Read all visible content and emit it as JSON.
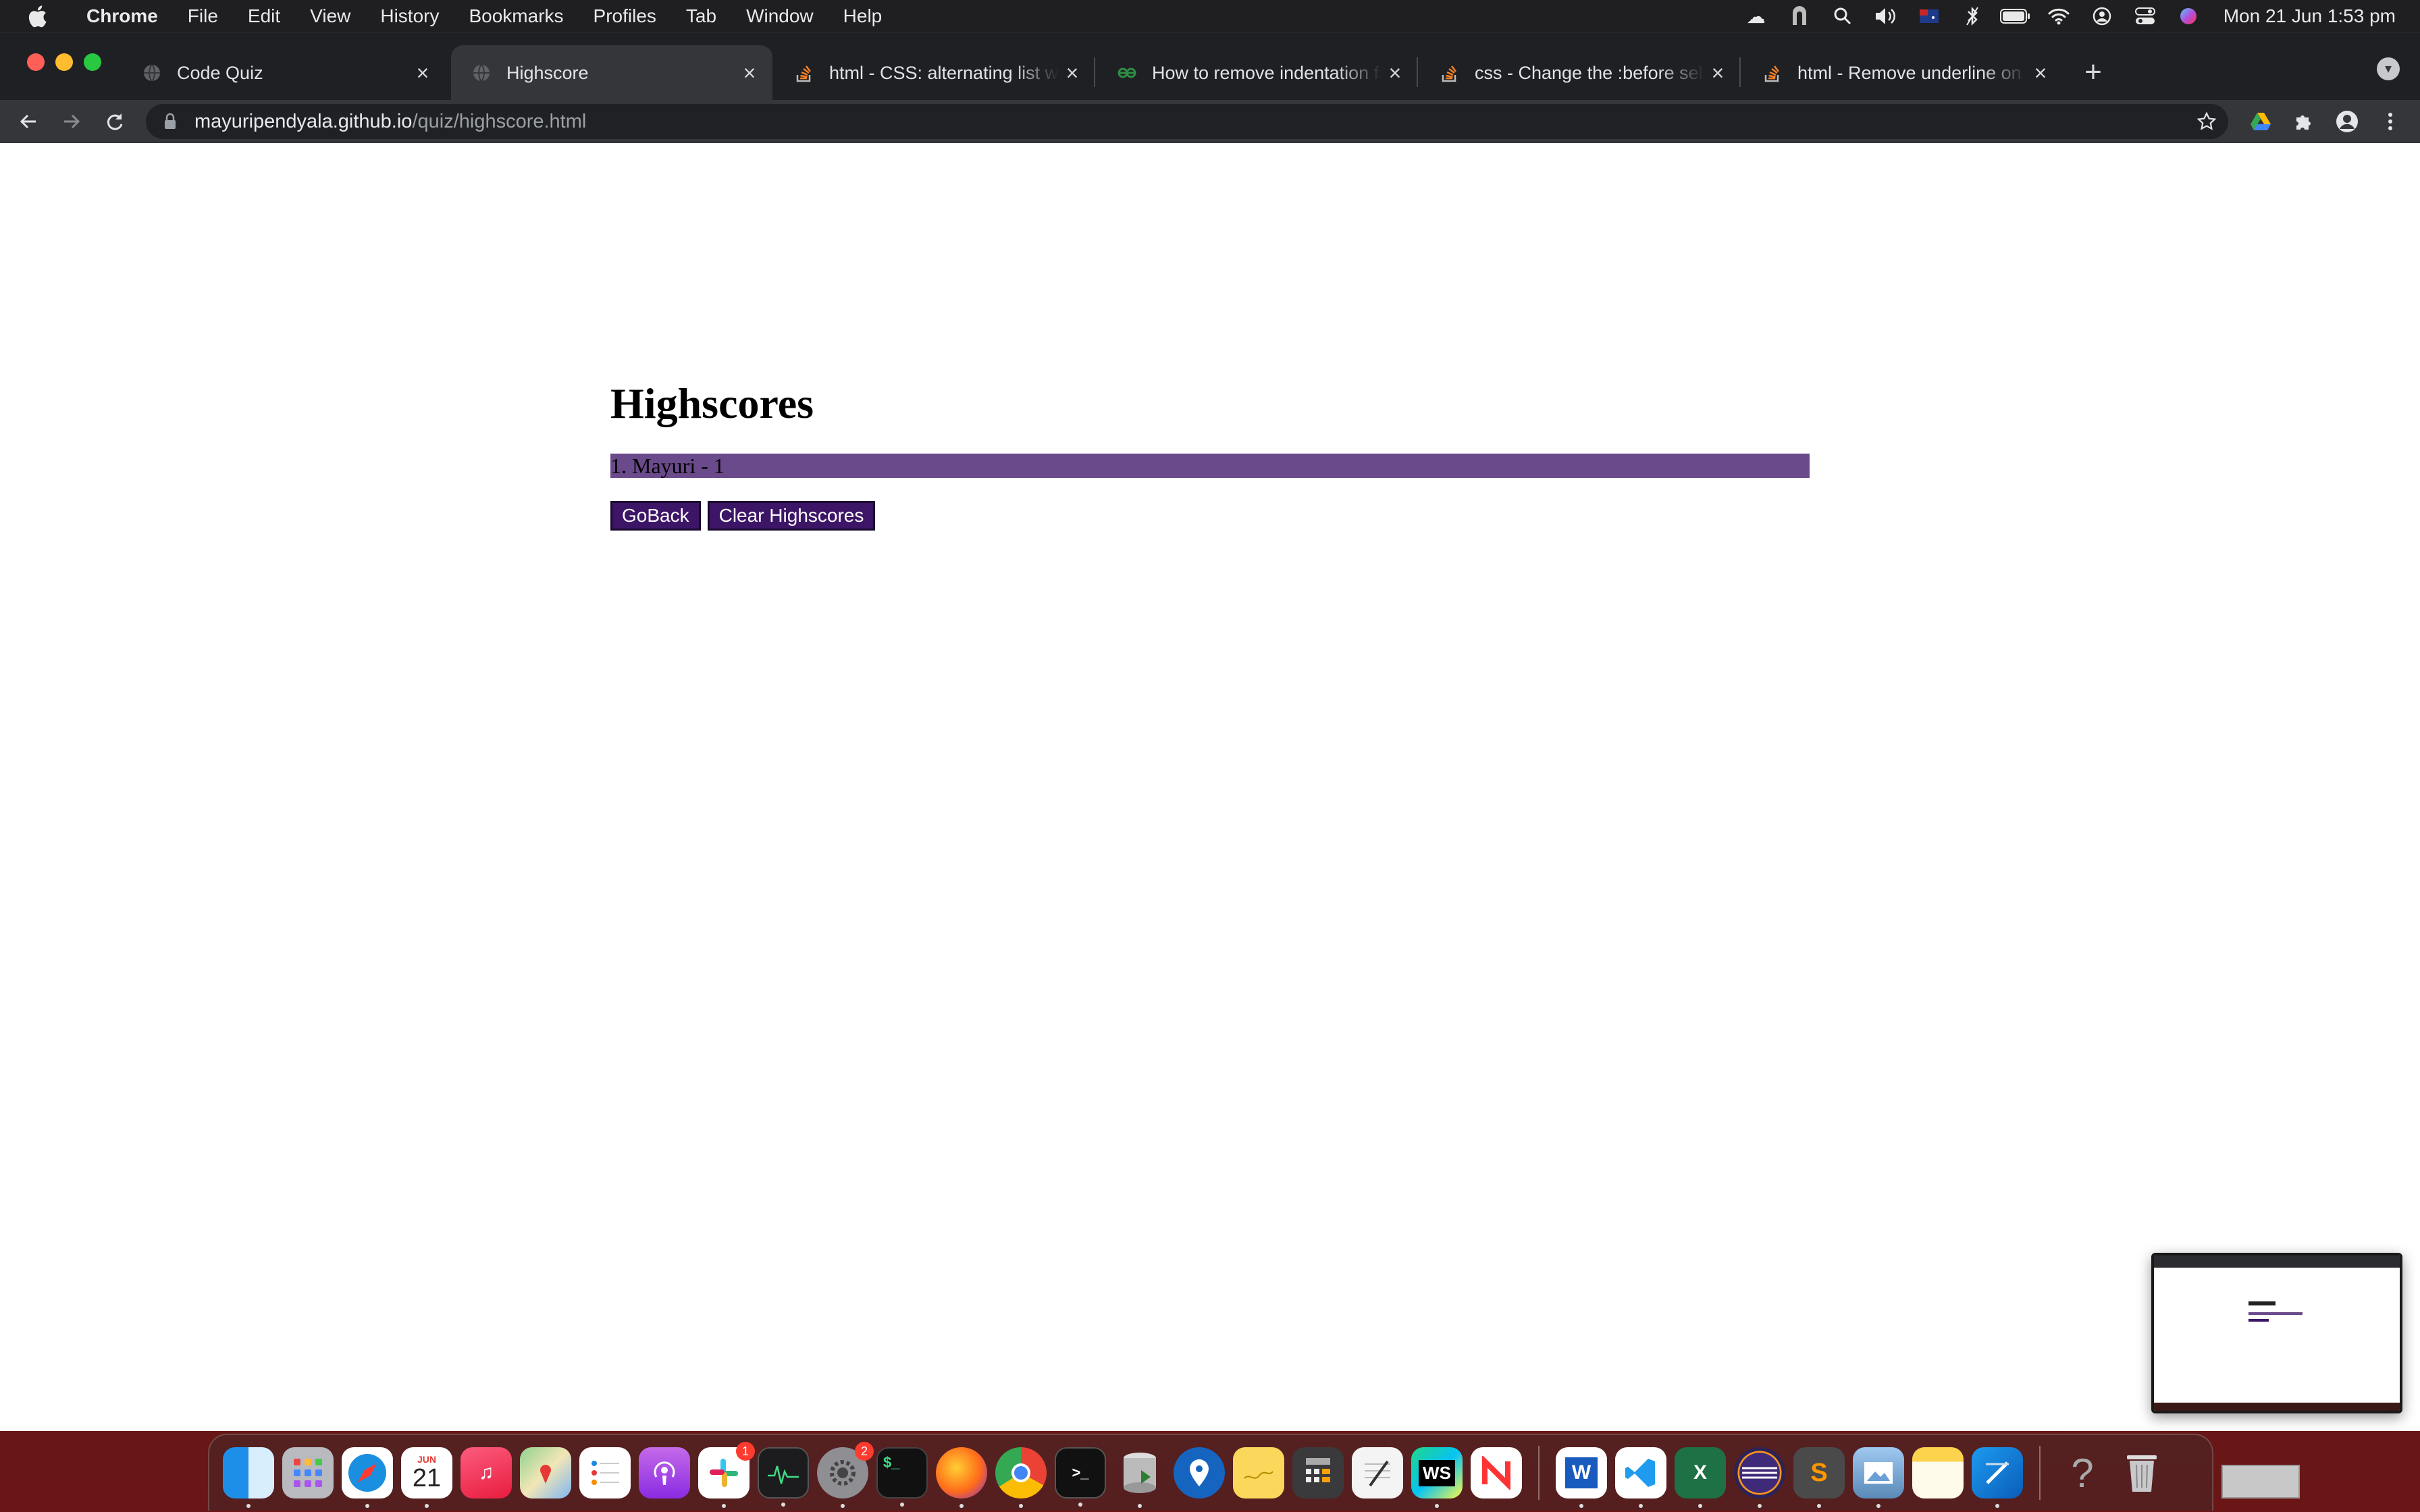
{
  "menubar": {
    "app_name": "Chrome",
    "items": [
      "File",
      "Edit",
      "View",
      "History",
      "Bookmarks",
      "Profiles",
      "Tab",
      "Window",
      "Help"
    ],
    "status_icons": [
      "cloud-sync-icon",
      "vpn-icon",
      "spotlight-icon",
      "volume-icon",
      "flag-icon",
      "bluetooth-icon",
      "battery-icon",
      "wifi-icon",
      "user-icon",
      "control-center-icon",
      "siri-icon"
    ],
    "clock": "Mon 21 Jun  1:53 pm"
  },
  "tabs": [
    {
      "title": "Code Quiz",
      "favicon": "globe-icon",
      "active": false
    },
    {
      "title": "Highscore",
      "favicon": "globe-icon",
      "active": true
    },
    {
      "title": "html - CSS: alternating list with",
      "favicon": "stackoverflow-icon",
      "active": false
    },
    {
      "title": "How to remove indentation from",
      "favicon": "geeks-icon",
      "active": false
    },
    {
      "title": "css - Change the :before selecto",
      "favicon": "stackoverflow-icon",
      "active": false
    },
    {
      "title": "html - Remove underline on sp",
      "favicon": "stackoverflow-icon",
      "active": false
    }
  ],
  "address_bar": {
    "host": "mayuripendyala.github.io",
    "path": "/quiz/highscore.html"
  },
  "page": {
    "title": "Highscores",
    "scores": [
      "1. Mayuri - 1"
    ],
    "go_back_label": "GoBack",
    "clear_label": "Clear Highscores"
  },
  "colors": {
    "score_row_bg": "#6a4a8a",
    "button_bg": "#3d1566"
  },
  "dock": {
    "apps": [
      {
        "name": "Finder",
        "icon": "finder-icon"
      },
      {
        "name": "Launchpad",
        "icon": "launchpad-icon"
      },
      {
        "name": "Safari",
        "icon": "safari-icon"
      },
      {
        "name": "Calendar",
        "icon": "calendar-icon",
        "label_top": "JUN",
        "label_main": "21"
      },
      {
        "name": "Music",
        "icon": "music-icon"
      },
      {
        "name": "Maps",
        "icon": "maps-icon"
      },
      {
        "name": "Reminders",
        "icon": "reminders-icon"
      },
      {
        "name": "Podcasts",
        "icon": "podcasts-icon"
      },
      {
        "name": "Slack",
        "icon": "slack-icon",
        "badge": "1"
      },
      {
        "name": "Activity Monitor",
        "icon": "activity-monitor-icon"
      },
      {
        "name": "System Preferences",
        "icon": "settings-icon",
        "badge": "2"
      },
      {
        "name": "Terminal (alt)",
        "icon": "terminal-alt-icon"
      },
      {
        "name": "Firefox",
        "icon": "firefox-icon"
      },
      {
        "name": "Chrome",
        "icon": "chrome-icon"
      },
      {
        "name": "Terminal",
        "icon": "terminal-icon"
      },
      {
        "name": "Database",
        "icon": "database-icon"
      },
      {
        "name": "Location",
        "icon": "location-icon"
      },
      {
        "name": "Stickies",
        "icon": "stickies-icon"
      },
      {
        "name": "Calculator",
        "icon": "calculator-icon"
      },
      {
        "name": "TextEdit",
        "icon": "textedit-icon"
      },
      {
        "name": "WebStorm",
        "icon": "webstorm-icon",
        "label_main": "WS"
      },
      {
        "name": "News",
        "icon": "news-icon"
      },
      {
        "name": "Word",
        "icon": "word-icon",
        "label_main": "W"
      },
      {
        "name": "VS Code",
        "icon": "vscode-icon"
      },
      {
        "name": "Excel",
        "icon": "excel-icon",
        "label_main": "X"
      },
      {
        "name": "Eclipse",
        "icon": "eclipse-icon"
      },
      {
        "name": "Sublime Text",
        "icon": "sublime-icon",
        "label_main": "S"
      },
      {
        "name": "Preview",
        "icon": "preview-icon"
      },
      {
        "name": "Notes",
        "icon": "notes-icon"
      },
      {
        "name": "Xcode",
        "icon": "xcode-icon"
      },
      {
        "name": "Help",
        "icon": "help-icon",
        "label_main": "?"
      },
      {
        "name": "Trash",
        "icon": "trash-icon"
      }
    ]
  }
}
